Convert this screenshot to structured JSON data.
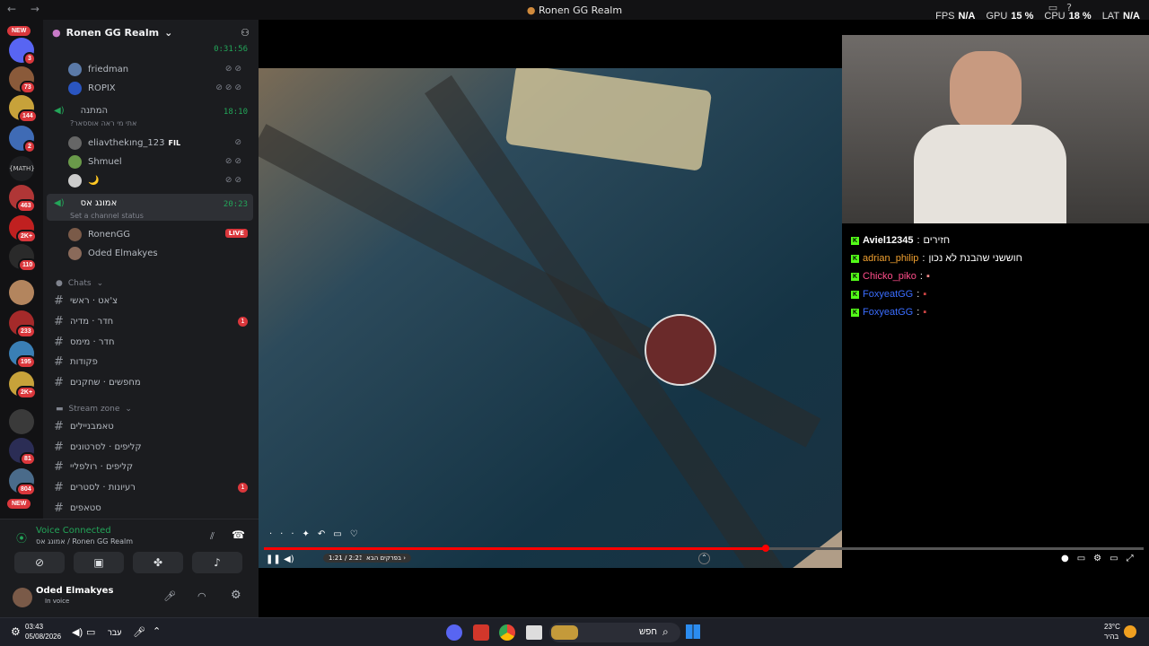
{
  "window": {
    "title": "Ronen GG Realm",
    "nav": "← →"
  },
  "stats": [
    {
      "label": "FPS",
      "value": "N/A"
    },
    {
      "label": "GPU",
      "value": "15 %"
    },
    {
      "label": "CPU",
      "value": "18 %"
    },
    {
      "label": "LAT",
      "value": "N/A"
    }
  ],
  "servers": {
    "new_top": "NEW",
    "new_bottom": "NEW",
    "badges": [
      "3",
      "73",
      "144",
      "2",
      "463",
      "2K+",
      "110",
      "233",
      "195",
      "2K+",
      "81",
      "804"
    ],
    "math_label": "{MATH}"
  },
  "server_name": "Ronen GG Realm",
  "voice_channels": [
    {
      "name": "friedman",
      "kind": "user"
    },
    {
      "name": "ROPIX",
      "kind": "user"
    },
    {
      "name": "המתנה",
      "time": "18:10",
      "status": "?אתי מי ראה אוססאר"
    },
    {
      "name": "eliavthekıng_123",
      "tag": "FIL"
    },
    {
      "name": "Shmuel"
    },
    {
      "name": "🌙"
    },
    {
      "name": "אמונג אס",
      "time": "20:23",
      "status": "Set a channel status"
    },
    {
      "name": "RonenGG",
      "live": "LIVE"
    },
    {
      "name": "Oded Elmakyes"
    }
  ],
  "top_time": "0:31:56",
  "chats_category": "Chats",
  "chat_channels": [
    {
      "name": "צ'אט · ראשי",
      "badge": ""
    },
    {
      "name": "חדר · מדיה",
      "badge": "1"
    },
    {
      "name": "חדר · מימס",
      "badge": ""
    },
    {
      "name": "פקודות",
      "badge": ""
    },
    {
      "name": "מחפשים · שחקנים",
      "badge": ""
    }
  ],
  "stream_category": "Stream zone",
  "stream_channels": [
    {
      "name": "טאמבניילים",
      "badge": ""
    },
    {
      "name": "קליפים · לסרטונים",
      "badge": ""
    },
    {
      "name": "קליפים · רולפליי",
      "badge": ""
    },
    {
      "name": "רעיונות · לסטרים",
      "badge": "1"
    },
    {
      "name": "סטאפים",
      "badge": ""
    }
  ],
  "voice_status": {
    "title": "Voice Connected",
    "sub": "אמונג אס / Ronen GG Realm"
  },
  "user": {
    "name": "Oded Elmakyes",
    "status": "In voice"
  },
  "stream_chat": [
    {
      "user": "Aviel12345",
      "msg": "חזירים",
      "color": "#ffffff"
    },
    {
      "user": "adrian_philip",
      "msg": "חוששני שהבנת לא נכון",
      "color": "#f0a030"
    },
    {
      "user": "Chicko_piko",
      "msg": "",
      "color": "#ff4d8a"
    },
    {
      "user": "FoxyeatGG",
      "msg": "",
      "color": "#3a6dff"
    },
    {
      "user": "FoxyeatGG",
      "msg": "",
      "color": "#3a6dff"
    }
  ],
  "player": {
    "time": "1:21 / 2:21",
    "chapter": "בפרקים הבא ›",
    "progress": 0.57
  },
  "taskbar": {
    "time": "03:43",
    "date": "05/08/2026",
    "lang": "עבר",
    "search": "חפש",
    "weather": "23°C",
    "weather_sub": "בהיר"
  }
}
